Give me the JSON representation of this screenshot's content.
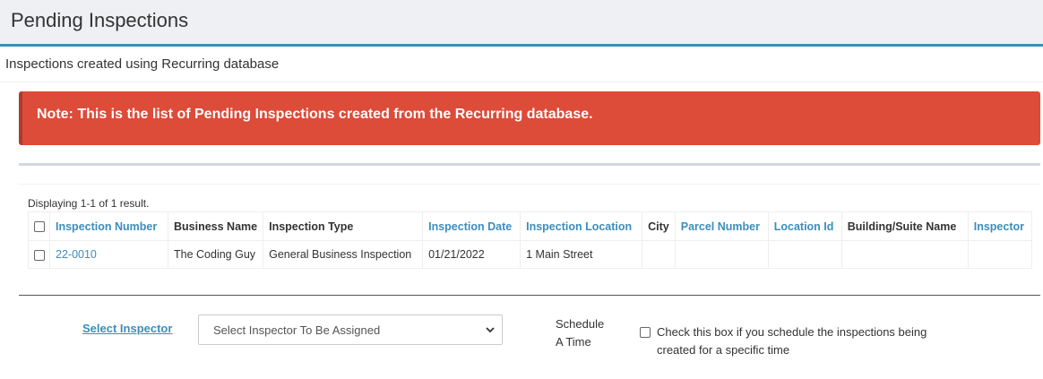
{
  "header": {
    "title": "Pending Inspections"
  },
  "subtitle": "Inspections created using Recurring database",
  "alert": {
    "text": "Note: This is the list of Pending Inspections created from the Recurring database."
  },
  "grid": {
    "summary": "Displaying 1-1 of 1 result.",
    "columns": [
      {
        "label": "Inspection Number",
        "sortable": true
      },
      {
        "label": "Business Name",
        "sortable": false
      },
      {
        "label": "Inspection Type",
        "sortable": false
      },
      {
        "label": "Inspection Date",
        "sortable": true
      },
      {
        "label": "Inspection Location",
        "sortable": true
      },
      {
        "label": "City",
        "sortable": false
      },
      {
        "label": "Parcel Number",
        "sortable": true
      },
      {
        "label": "Location Id",
        "sortable": true
      },
      {
        "label": "Building/Suite Name",
        "sortable": false
      },
      {
        "label": "Inspector",
        "sortable": true
      }
    ],
    "rows": [
      {
        "inspection_number": "22-0010",
        "business_name": "The Coding Guy",
        "inspection_type": "General Business Inspection",
        "inspection_date": "01/21/2022",
        "inspection_location": "1 Main Street",
        "city": "",
        "parcel_number": "",
        "location_id": "",
        "building_suite_name": "",
        "inspector": ""
      }
    ]
  },
  "assign": {
    "select_label": "Select Inspector",
    "select_value": "Select Inspector To Be Assigned",
    "schedule_line1": "Schedule",
    "schedule_line2": "A Time",
    "time_checkbox_text": "Check this box if you schedule the inspections being created for a specific time"
  },
  "colors": {
    "accent": "#3c8dbc",
    "alert": "#dd4b39",
    "header_bg": "#eef0f4"
  }
}
